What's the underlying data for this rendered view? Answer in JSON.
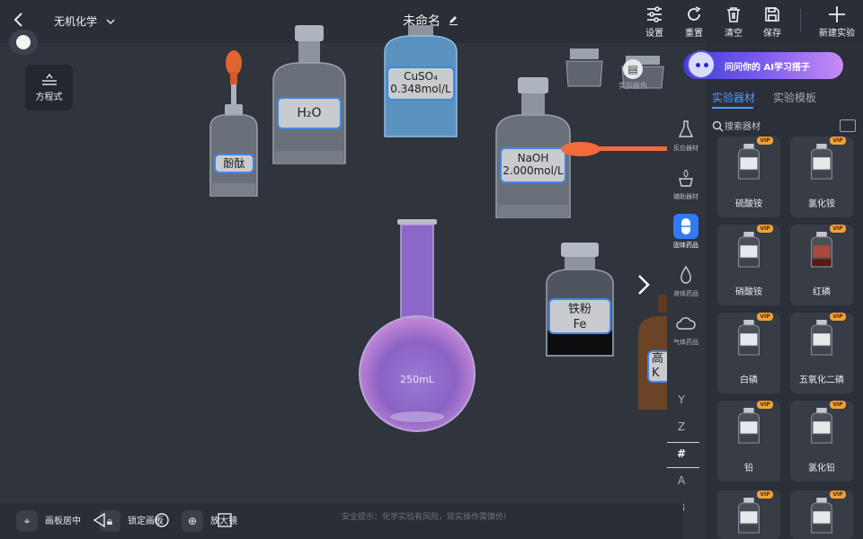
{
  "header": {
    "category": "无机化学",
    "title": "未命名",
    "tools": [
      {
        "label": "设置",
        "icon": "sliders-icon"
      },
      {
        "label": "重置",
        "icon": "refresh-icon"
      },
      {
        "label": "清空",
        "icon": "trash-icon"
      },
      {
        "label": "保存",
        "icon": "save-icon"
      },
      {
        "label": "新建实验",
        "icon": "plus-icon"
      }
    ]
  },
  "left_tools": {
    "equation": "方程式"
  },
  "canvas": {
    "labels": {
      "phenolphthalein": "酚酞",
      "water": "H₂O",
      "cuso4_name": "CuSO₄",
      "cuso4_conc": "0.348mol/L",
      "naoh_name": "NaOH",
      "naoh_conc": "2.000mol/L",
      "iron_name": "铁粉",
      "iron_formula": "Fe",
      "flask_volume": "250mL",
      "brown_bottle_partial": "高",
      "brown_bottle_partial2": "K"
    },
    "report": "实验报告"
  },
  "ai_banner": "问问你的 AI学习搭子",
  "panel": {
    "tabs": [
      "实验器材",
      "实验模板"
    ],
    "active_tab": 0,
    "search_placeholder": "搜索器材",
    "side_categories": [
      "反应器材",
      "辅助器材",
      "固体药品",
      "液体药品",
      "气体药品"
    ],
    "active_category": 2,
    "alpha_index": [
      "Y",
      "Z",
      "#",
      "A",
      "B"
    ],
    "vip_badge": "VIP",
    "items": [
      "硫酸铵",
      "氯化铵",
      "硝酸铵",
      "红磷",
      "白磷",
      "五氧化二磷",
      "铅",
      "氯化铅",
      "",
      ""
    ]
  },
  "bottom": {
    "center": "画板居中",
    "lock": "锁定画板",
    "magnifier": "放大镜",
    "safety": "安全提示：化学实验有风险，现实操作需慎仿!"
  },
  "colors": {
    "accent": "#2f7cf6",
    "label_border": "#3f86e8",
    "vip": "#f0a23a"
  }
}
